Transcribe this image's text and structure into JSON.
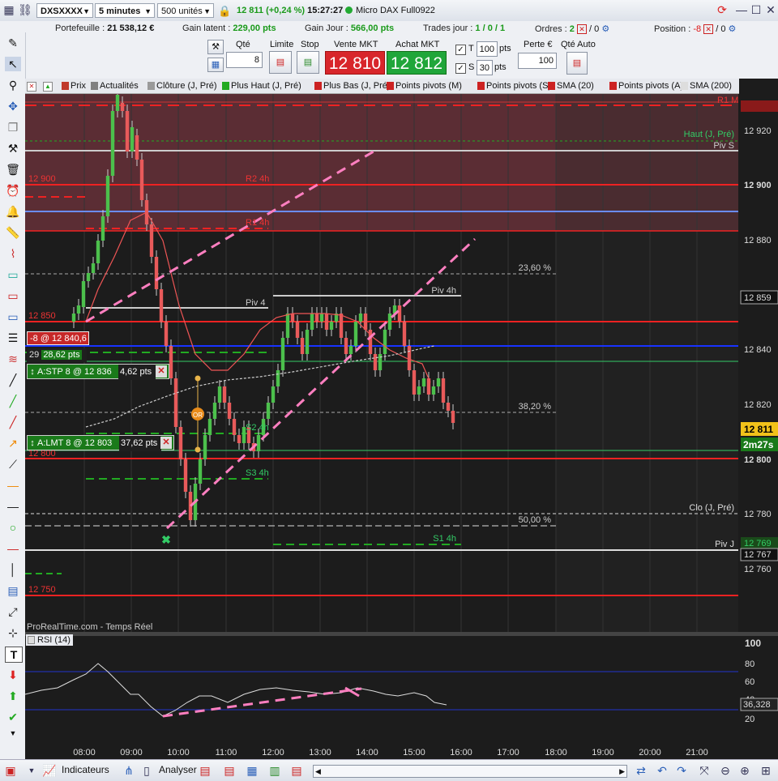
{
  "titlebar": {
    "symbol": "DXSXXXX",
    "timeframe": "5 minutes",
    "units": "500 unités",
    "price_change": "12 811 (+0,24 %)",
    "time": "15:27:27",
    "instrument": "Micro DAX Full0922"
  },
  "infobar": {
    "portfolio_label": "Portefeuille :",
    "portfolio_value": "21 538,12 €",
    "latent_label": "Gain latent :",
    "latent_value": "229,00 pts",
    "day_gain_label": "Gain Jour :",
    "day_gain_value": "566,00 pts",
    "trades_label": "Trades jour :",
    "trades_value": "1 / 0 / 1",
    "orders_label": "Ordres :",
    "orders_value": "2",
    "orders_zero": "0",
    "position_label": "Position :",
    "position_value": "-8",
    "position_zero": "0"
  },
  "orderbar": {
    "qty_label": "Qté",
    "qty_value": "8",
    "limit_label": "Limite",
    "stop_label": "Stop",
    "sell_label": "Vente MKT",
    "sell_price": "12 810",
    "buy_label": "Achat MKT",
    "buy_price": "12 812",
    "t_label": "T",
    "t_value": "100",
    "s_label": "S",
    "s_value": "30",
    "pts_label": "pts",
    "loss_label": "Perte €",
    "loss_value": "100",
    "auto_label": "Qté Auto"
  },
  "tags": [
    {
      "label": "Prix",
      "color": "#c0392b"
    },
    {
      "label": "Actualités",
      "color": "#808080"
    },
    {
      "label": "Clôture (J, Pré)",
      "color": "#9a9a9a"
    },
    {
      "label": "Plus Haut (J, Pré)",
      "color": "#22aa22"
    },
    {
      "label": "Plus Bas (J, Pré)",
      "color": "#cc2222"
    },
    {
      "label": "Points pivots (M)",
      "color": "#cc2222"
    },
    {
      "label": "Points pivots (S)",
      "color": "#cc2222"
    },
    {
      "label": "SMA (20)",
      "color": "#cc2222"
    },
    {
      "label": "Points pivots (A)",
      "color": "#cc2222"
    },
    {
      "label": "SMA (200)",
      "color": "#dddddd"
    }
  ],
  "chart_data": {
    "type": "candlestick",
    "price_axis": [
      "12 920",
      "12 900",
      "12 880",
      "12 859",
      "12 840",
      "12 820",
      "12 811",
      "12 800",
      "12 780",
      "12 769",
      "12 767",
      "12 760"
    ],
    "time_axis": [
      "08:00",
      "09:00",
      "10:00",
      "11:00",
      "12:00",
      "13:00",
      "14:00",
      "15:00",
      "16:00",
      "17:00",
      "18:00",
      "19:00",
      "20:00",
      "21:00"
    ],
    "countdown": "2m27s",
    "current_price": "12 811",
    "level_labels": {
      "r2_m": "R1 M",
      "haut": "Haut (J, Pré)",
      "piv_s": "Piv S",
      "l12900": "12 900",
      "r2_4h": "R2 4h",
      "r1_4h": "R1 4h",
      "fib236": "23,60 %",
      "piv4h": "Piv 4h",
      "piv4": "Piv 4",
      "l12850": "12 850",
      "fib382": "38,20 %",
      "s24h": "S2 4h",
      "l12800": "12 800",
      "s34h": "S3 4h",
      "clo": "Clo (J, Pré)",
      "fib50": "50,00 %",
      "s14h": "S1 4h",
      "piv_j": "Piv J",
      "l12750": "12 750",
      "r1_4h_b": "R1 4h",
      "or": "OR"
    },
    "source_label": "ProRealTime.com - Temps Réel",
    "rsi": {
      "label": "RSI (14)",
      "axis": [
        "100",
        "80",
        "60",
        "40",
        "36,328",
        "20"
      ]
    },
    "orders": {
      "position": "-8 @ 12 840,6",
      "position_qty": "29",
      "position_pts": "28,62 pts",
      "stop": "A:STP  8 @ 12 836",
      "stop_pts": "4,62 pts",
      "limit": "A:LMT  8 @ 12 803",
      "limit_pts": "37,62 pts"
    }
  },
  "bottombar": {
    "indicators": "Indicateurs",
    "analyse": "Analyser"
  }
}
